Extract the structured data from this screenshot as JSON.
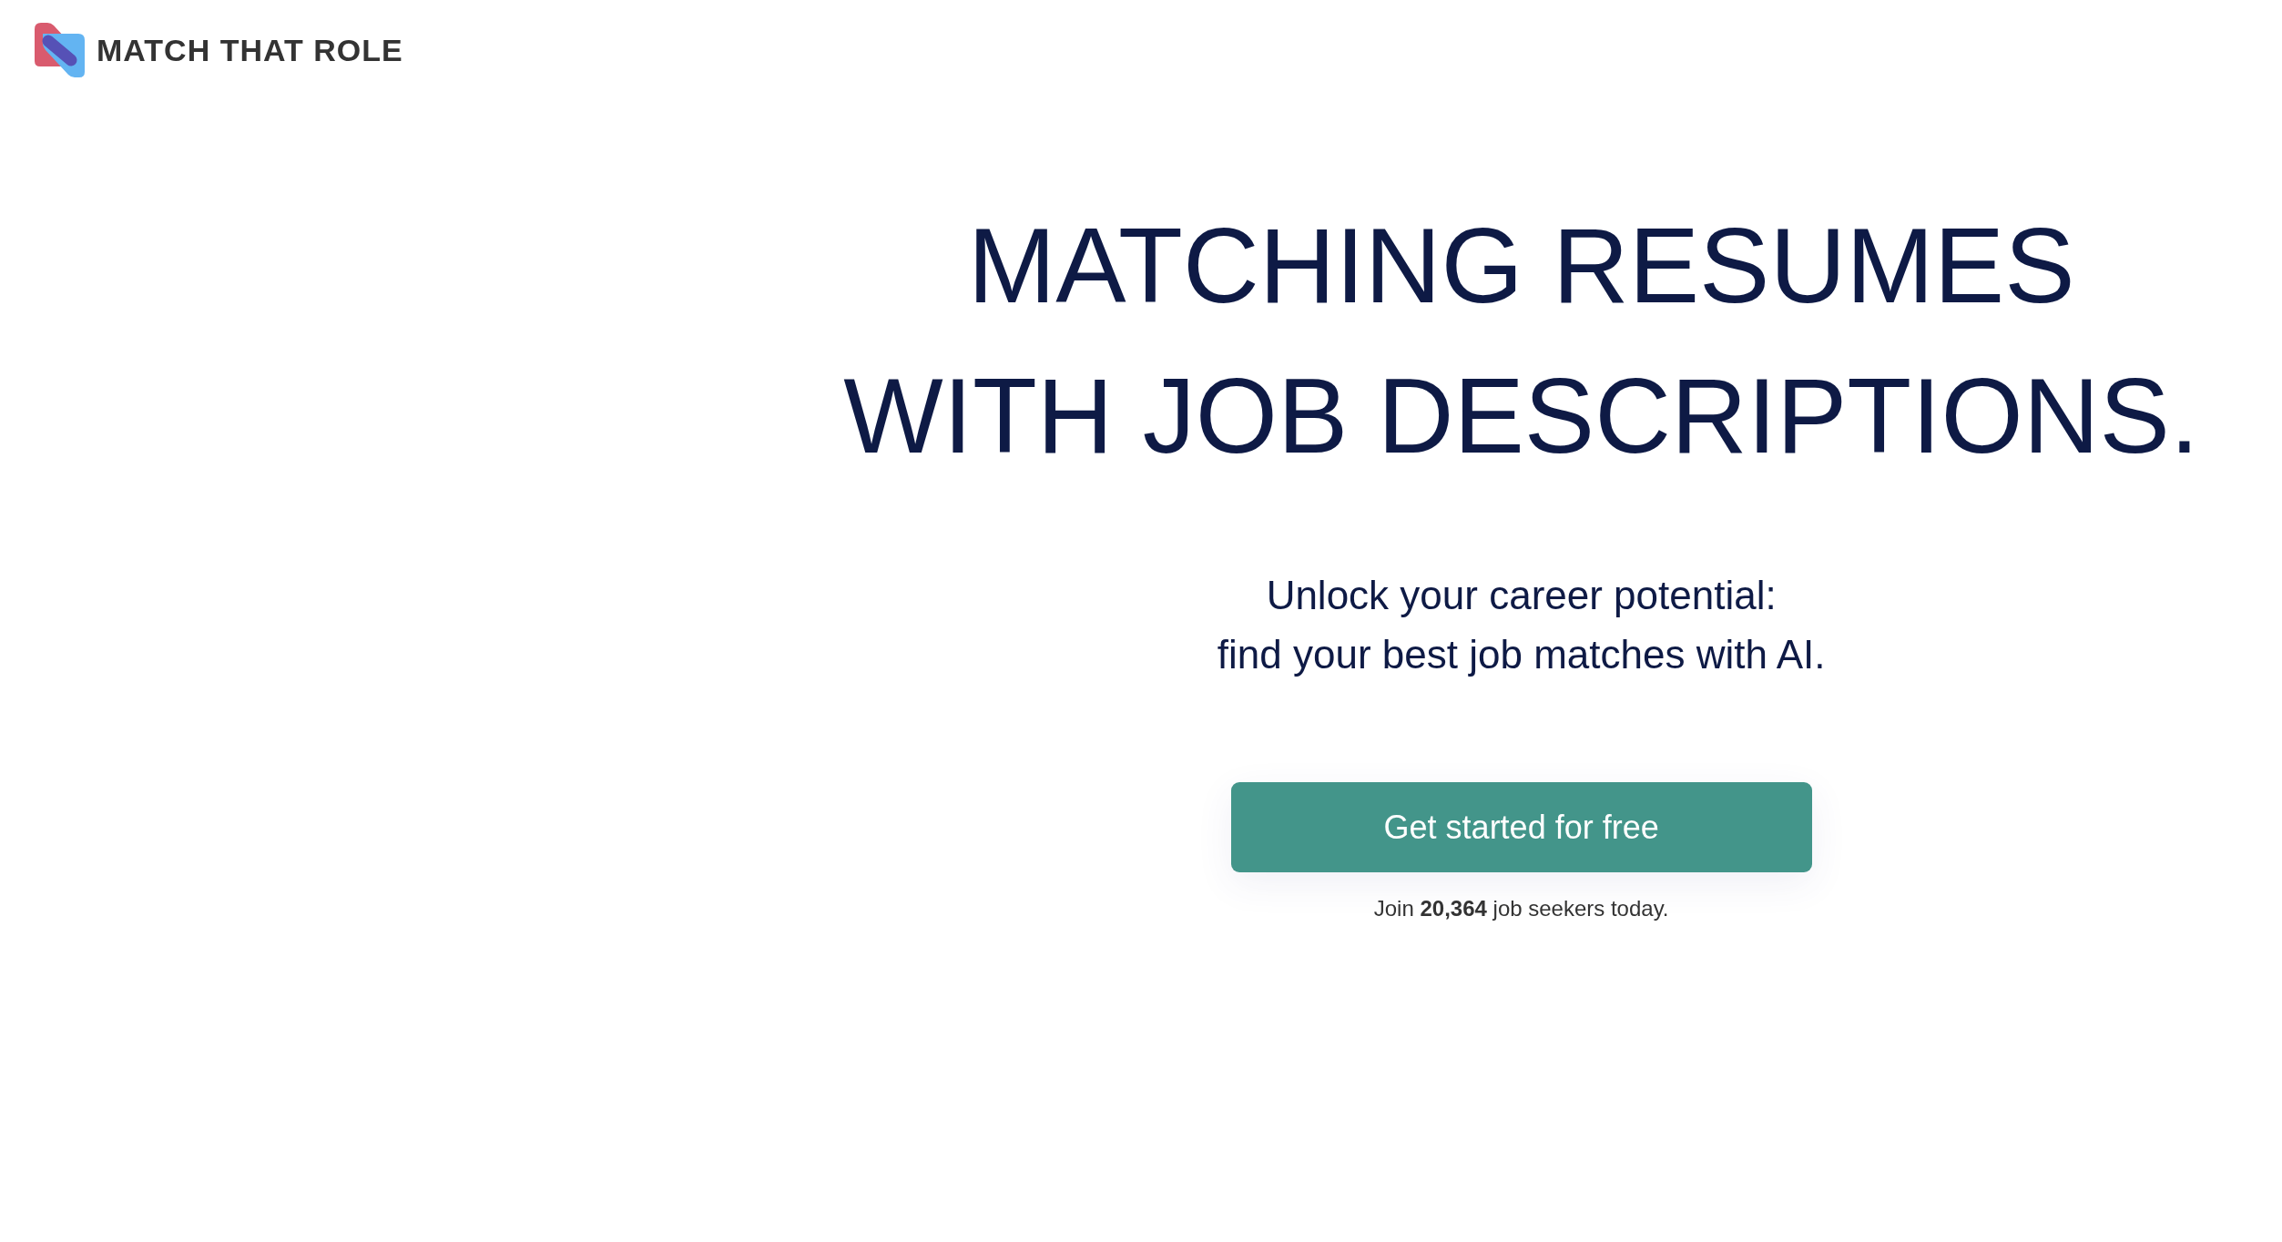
{
  "header": {
    "logo_text": "MATCH THAT ROLE"
  },
  "hero": {
    "headline_lines": [
      "MATCHING RESUMES",
      "WITH JOB DESCRIPTIONS."
    ],
    "subtitle_lines": [
      "Unlock your career potential:",
      "find your best job matches with AI."
    ],
    "cta_button": "Get started for free",
    "social_proof": "Join **20,364** job seekers today."
  }
}
